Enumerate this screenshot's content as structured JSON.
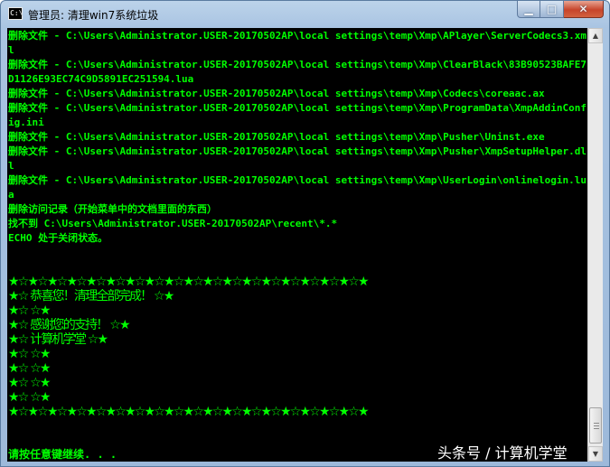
{
  "window": {
    "title": "管理员: 清理win7系统垃圾",
    "icon_text": "C:\\",
    "controls": {
      "minimize": "▁",
      "maximize": "□",
      "close": "✕"
    }
  },
  "console": {
    "text": "删除文件 - C:\\Users\\Administrator.USER-20170502AP\\local settings\\temp\\Xmp\\APlayer\\ServerCodecs3.xml\n删除文件 - C:\\Users\\Administrator.USER-20170502AP\\local settings\\temp\\Xmp\\ClearBlack\\83B90523BAFE7D1126E93EC74C9D5891EC251594.lua\n删除文件 - C:\\Users\\Administrator.USER-20170502AP\\local settings\\temp\\Xmp\\Codecs\\coreaac.ax\n删除文件 - C:\\Users\\Administrator.USER-20170502AP\\local settings\\temp\\Xmp\\ProgramData\\XmpAddinConfig.ini\n删除文件 - C:\\Users\\Administrator.USER-20170502AP\\local settings\\temp\\Xmp\\Pusher\\Uninst.exe\n删除文件 - C:\\Users\\Administrator.USER-20170502AP\\local settings\\temp\\Xmp\\Pusher\\XmpSetupHelper.dll\n删除文件 - C:\\Users\\Administrator.USER-20170502AP\\local settings\\temp\\Xmp\\UserLogin\\onlinelogin.lua\n删除访问记录（开始菜单中的文档里面的东西）\n找不到 C:\\Users\\Administrator.USER-20170502AP\\recent\\*.*\nECHO 处于关闭状态。",
    "star_lines": [
      "★☆★☆★☆★☆★☆★☆★☆★☆★☆★☆★☆★☆★☆★☆★☆★☆★☆★☆★",
      "★☆ 恭喜您！清理全部完成！ ☆★",
      "★☆ ☆★",
      "★☆ 感谢您的支持！ ☆★",
      "★☆ 计算机学堂 ☆★",
      "★☆ ☆★",
      "★☆ ☆★",
      "★☆ ☆★",
      "★☆ ☆★",
      "★☆★☆★☆★☆★☆★☆★☆★☆★☆★☆★☆★☆★☆★☆★☆★☆★☆★☆★"
    ],
    "prompt": "请按任意键继续. . .",
    "text_color": "#00ff00",
    "background": "#000000"
  },
  "scrollbar": {
    "up_arrow": "▲",
    "down_arrow": "▼"
  },
  "watermark": "头条号 / 计算机学堂"
}
